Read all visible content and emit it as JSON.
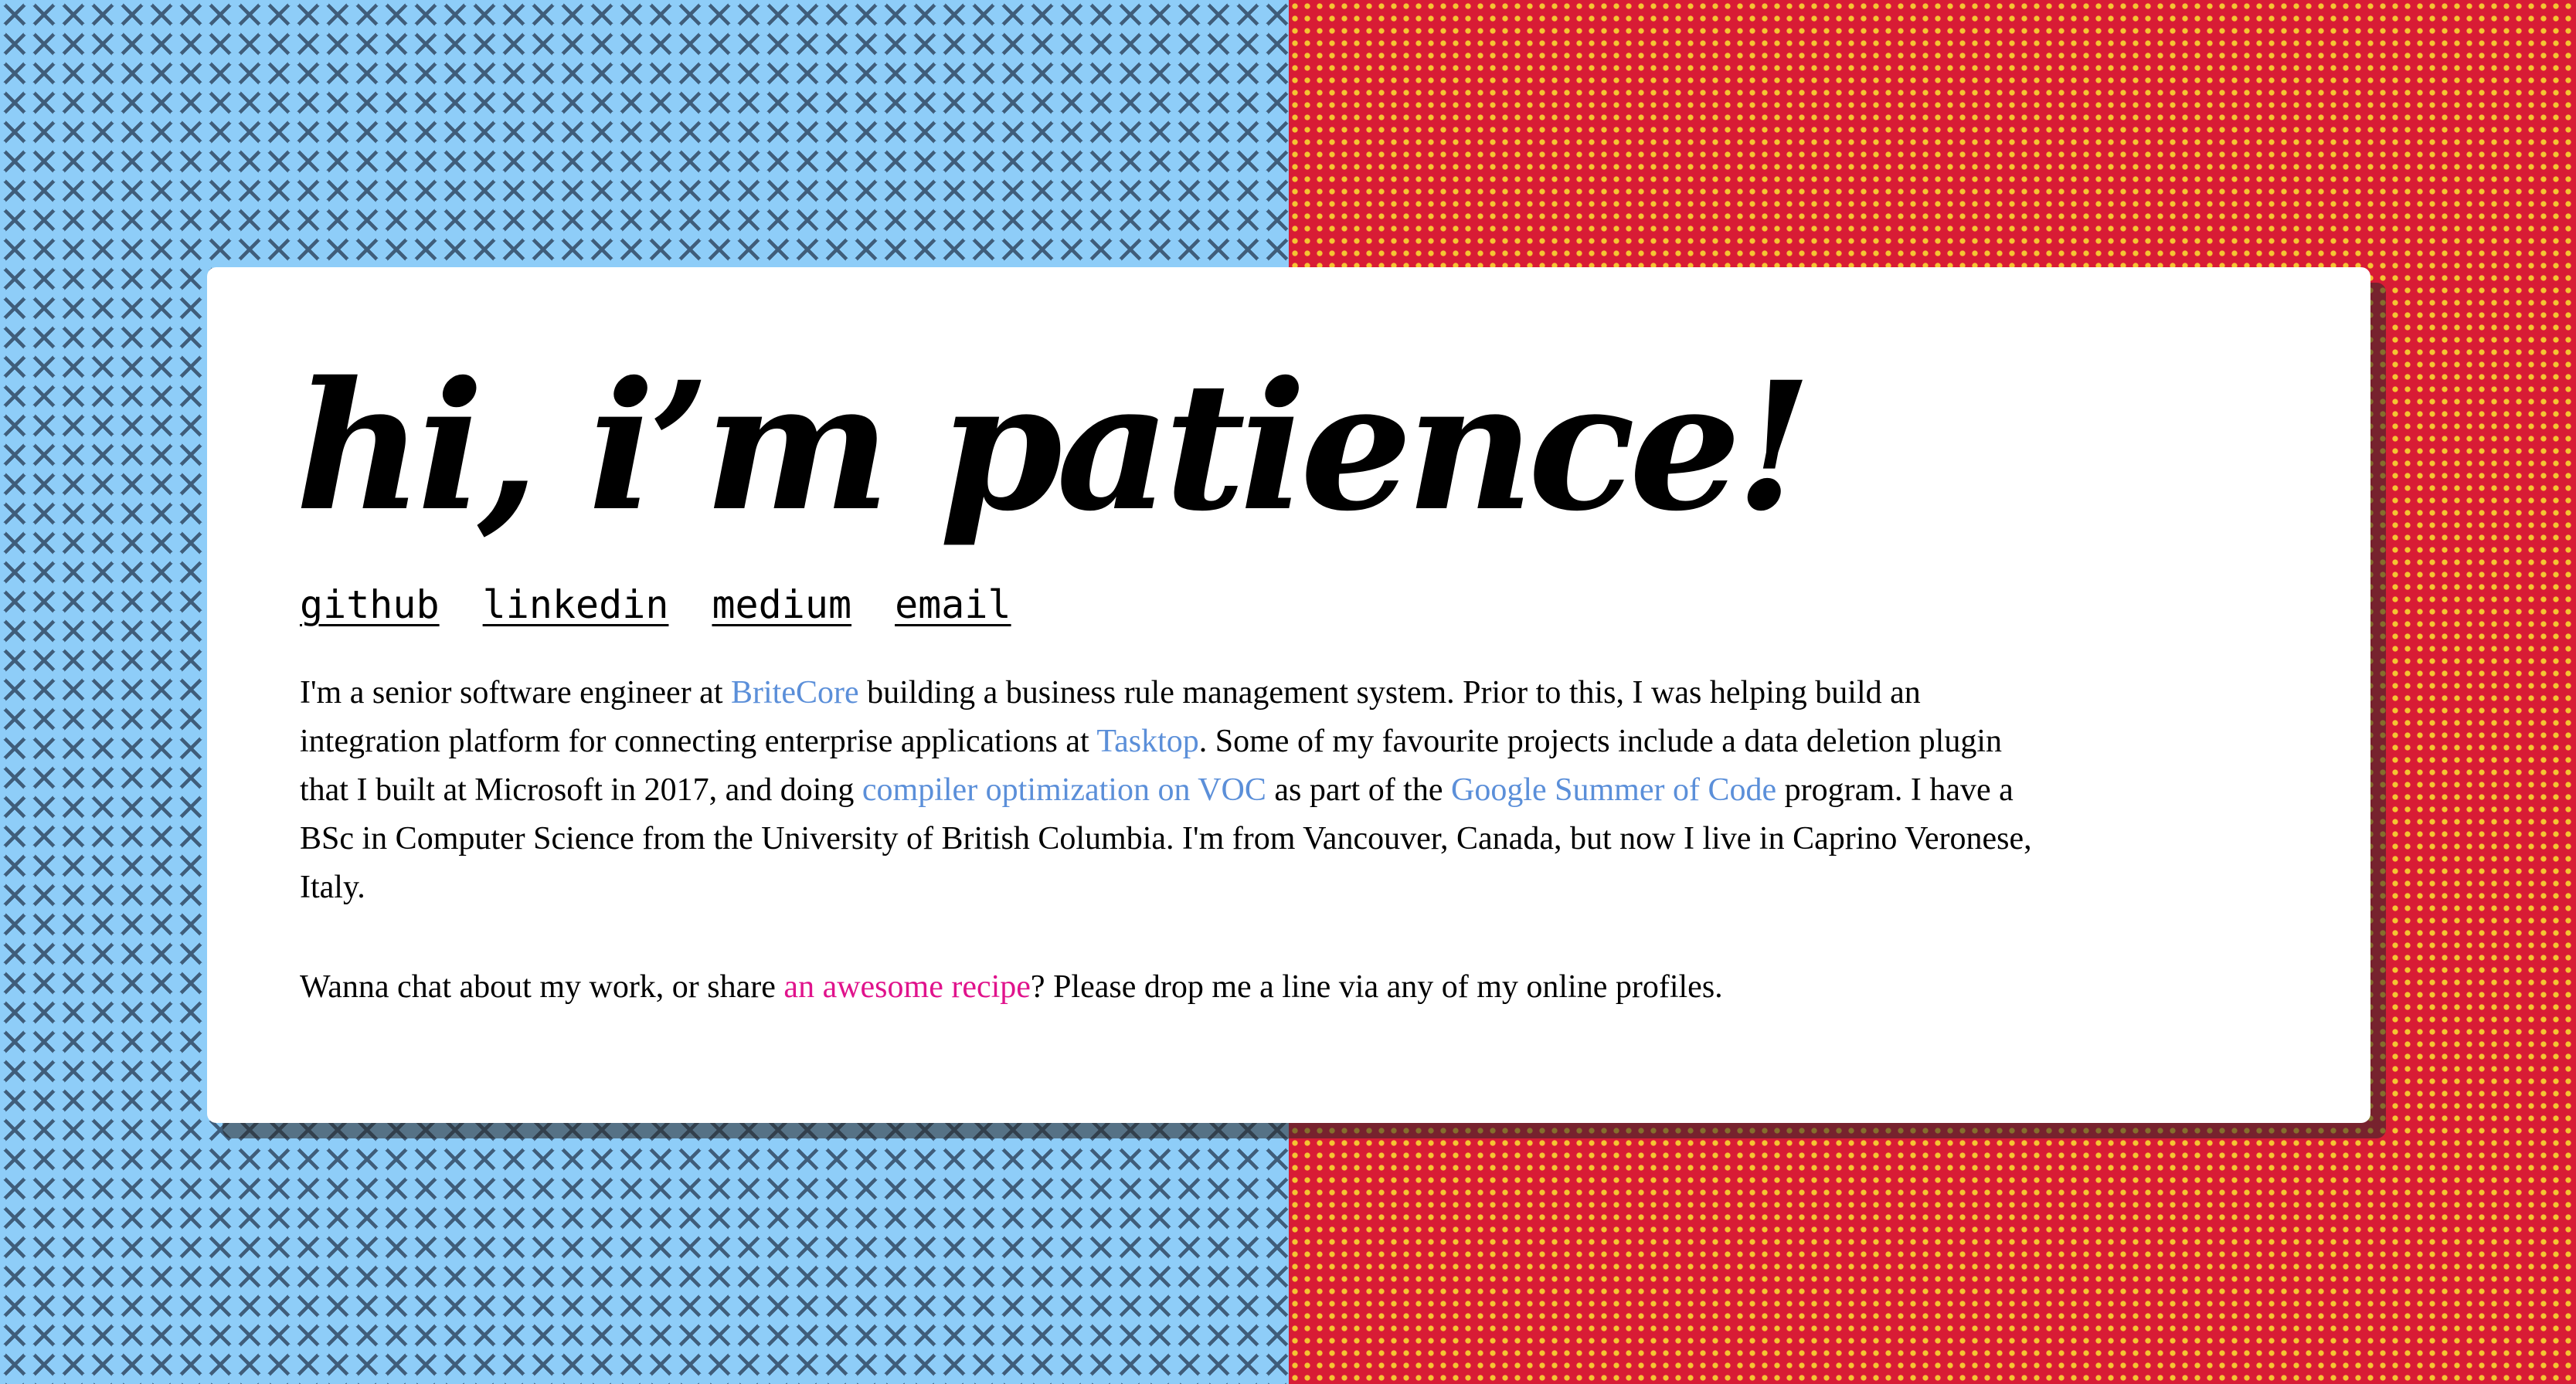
{
  "title": "hi, i’m patience!",
  "links": {
    "github": "github",
    "linkedin": "linkedin",
    "medium": "medium",
    "email": "email"
  },
  "bio": {
    "p1_t1": "I'm a senior software engineer at ",
    "britecore": "BriteCore",
    "p1_t2": " building a business rule management system. Prior to this, I was helping build an integration platform for connecting enterprise applications at ",
    "tasktop": "Tasktop",
    "p1_t3": ". Some of my favourite projects include a data deletion plugin that I built at Microsoft in 2017, and doing ",
    "voc": "compiler optimization on VOC",
    "p1_t4": " as part of the ",
    "gsoc": "Google Summer of Code",
    "p1_t5": " program. I have a BSc in Computer Science from the University of British Columbia. I'm from Vancouver, Canada, but now I live in Caprino Veronese, Italy.",
    "p2_t1": "Wanna chat about my work, or share ",
    "recipe": "an awesome recipe",
    "p2_t2": "? Please drop me a line via any of my online profiles."
  },
  "colors": {
    "left_bg": "#8ecdf8",
    "left_pattern": "#3f5d7a",
    "right_bg": "#d81c35",
    "right_dots": "#f4c532",
    "link_blue": "#5b8fd9",
    "link_pink": "#e0138c",
    "card": "#ffffff"
  }
}
